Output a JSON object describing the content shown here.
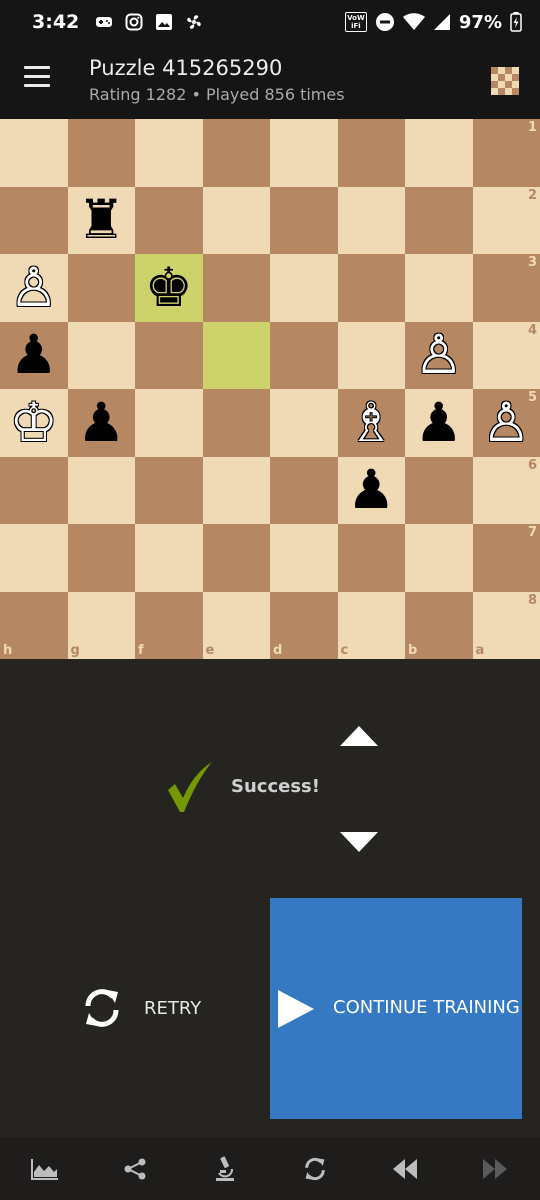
{
  "status_bar": {
    "time": "3:42",
    "battery_percent": "97%",
    "wifi_badge": "VoWiFi",
    "icons": [
      "game-controller-icon",
      "instagram-icon",
      "image-icon",
      "fan-icon",
      "wifi-calling-icon",
      "do-not-disturb-icon",
      "wifi-icon",
      "cellular-signal-icon",
      "battery-charging-icon"
    ]
  },
  "app_bar": {
    "title": "Puzzle 415265290",
    "subtitle": "Rating 1282 • Played 856 times",
    "menu_icon": "hamburger-menu-icon",
    "board_icon": "board-settings-icon"
  },
  "board": {
    "orientation": "black",
    "rank_labels": [
      "1",
      "2",
      "3",
      "4",
      "5",
      "6",
      "7",
      "8"
    ],
    "file_labels": [
      "h",
      "g",
      "f",
      "e",
      "d",
      "c",
      "b",
      "a"
    ],
    "rows": [
      [
        "",
        "",
        "",
        "",
        "",
        "",
        "",
        ""
      ],
      [
        "",
        "♜",
        "",
        "",
        "",
        "",
        "",
        ""
      ],
      [
        "♙",
        "",
        "♚",
        "",
        "",
        "",
        "",
        ""
      ],
      [
        "♟",
        "",
        "",
        "",
        "",
        "",
        "♙",
        ""
      ],
      [
        "♔",
        "♟",
        "",
        "",
        "",
        "♗",
        "♟",
        "♙"
      ],
      [
        "",
        "",
        "",
        "",
        "",
        "♟",
        "",
        ""
      ],
      [
        "",
        "",
        "",
        "",
        "",
        "",
        "",
        ""
      ],
      [
        "",
        "",
        "",
        "",
        "",
        "",
        "",
        ""
      ]
    ],
    "highlight_color": "#cdd26a",
    "light_color": "#f0d9b5",
    "dark_color": "#b58863"
  },
  "feedback": {
    "status_text": "Success!",
    "check_color": "#759900",
    "up_icon": "chevron-up-icon",
    "down_icon": "chevron-down-icon"
  },
  "actions": {
    "retry_label": "RETRY",
    "continue_label": "CONTINUE TRAINING",
    "continue_color": "#3579c2"
  },
  "bottom_bar": {
    "items": [
      "analysis-chart-icon",
      "share-icon",
      "microscope-icon",
      "flip-board-icon",
      "rewind-icon",
      "fast-forward-icon"
    ]
  }
}
